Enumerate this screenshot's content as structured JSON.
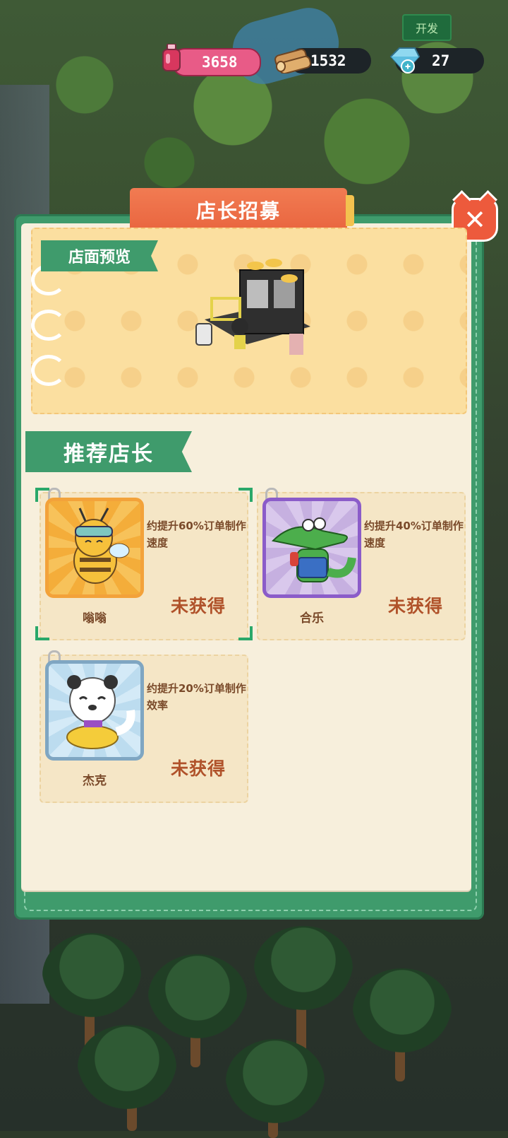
{
  "hud": {
    "dev_button": "开发",
    "potion": "3658",
    "wood": "1532",
    "gems": "27"
  },
  "dialog": {
    "title": "店长招募",
    "preview_label": "店面预览",
    "recommend_label": "推荐店长",
    "close_symbol": "✕"
  },
  "managers": [
    {
      "name": "嗡嗡",
      "desc": "约提升60%订单制作速度",
      "status": "未获得",
      "rarity": "orange",
      "selected": true
    },
    {
      "name": "合乐",
      "desc": "约提升40%订单制作速度",
      "status": "未获得",
      "rarity": "purple",
      "selected": false
    },
    {
      "name": "杰克",
      "desc": "约提升20%订单制作效率",
      "status": "未获得",
      "rarity": "blue",
      "selected": false
    }
  ],
  "colors": {
    "panel_green": "#3f9b6c",
    "paper": "#f7efdc",
    "title_orange": "#ef6f47",
    "status_text": "#b0522a",
    "rarity_orange": "#f3a23a",
    "rarity_purple": "#8b5cc9",
    "rarity_blue": "#7fa6c2"
  }
}
